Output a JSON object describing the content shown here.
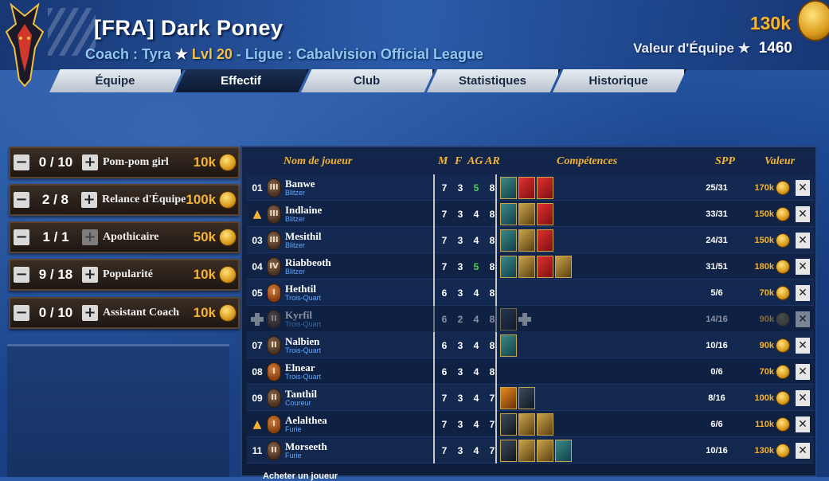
{
  "header": {
    "team_name": "[FRA] Dark Poney",
    "coach_label": "Coach : Tyra",
    "star": "★",
    "level": "Lvl 20",
    "league": " - Ligue : Cabalvision Official League",
    "gold": "130k",
    "team_value_label": "Valeur d'Équipe",
    "team_value": "1460"
  },
  "tabs": [
    {
      "label": "Équipe",
      "active": false
    },
    {
      "label": "Effectif",
      "active": true
    },
    {
      "label": "Club",
      "active": false
    },
    {
      "label": "Statistiques",
      "active": false
    },
    {
      "label": "Historique",
      "active": false
    }
  ],
  "resources": [
    {
      "count": "0 / 10",
      "label": "Pom-pom girl",
      "price": "10k",
      "minus_enabled": true,
      "plus_enabled": true
    },
    {
      "count": "2 / 8",
      "label": "Relance d'Équipe",
      "price": "100k",
      "minus_enabled": true,
      "plus_enabled": true
    },
    {
      "count": "1 / 1",
      "label": "Apothicaire",
      "price": "50k",
      "minus_enabled": true,
      "plus_enabled": false
    },
    {
      "count": "9 / 18",
      "label": "Popularité",
      "price": "10k",
      "minus_enabled": true,
      "plus_enabled": true
    },
    {
      "count": "0 / 10",
      "label": "Assistant Coach",
      "price": "10k",
      "minus_enabled": true,
      "plus_enabled": true
    }
  ],
  "roster_headers": {
    "name": "Nom de joueur",
    "m": "M",
    "f": "F",
    "ag": "AG",
    "ar": "AR",
    "skills": "Compétences",
    "spp": "SPP",
    "value": "Valeur"
  },
  "players": [
    {
      "num": "01",
      "marker": "number",
      "badge": "III",
      "name": "Banwe",
      "pos": "Blitzer",
      "m": "7",
      "f": "3",
      "ag": "5",
      "ag_green": true,
      "ar": "8",
      "skills": [
        "teal",
        "red-white",
        "red"
      ],
      "spp": "25/31",
      "value": "170k",
      "dimmed": false
    },
    {
      "num": "",
      "marker": "promo",
      "badge": "III",
      "name": "Indlaine",
      "pos": "Blitzer",
      "m": "7",
      "f": "3",
      "ag": "4",
      "ag_green": false,
      "ar": "8",
      "skills": [
        "teal",
        "gold",
        "red-white"
      ],
      "spp": "33/31",
      "value": "150k",
      "dimmed": false
    },
    {
      "num": "03",
      "marker": "number",
      "badge": "III",
      "name": "Mesithil",
      "pos": "Blitzer",
      "m": "7",
      "f": "3",
      "ag": "4",
      "ag_green": false,
      "ar": "8",
      "skills": [
        "teal",
        "gold",
        "red-white"
      ],
      "spp": "24/31",
      "value": "150k",
      "dimmed": false
    },
    {
      "num": "04",
      "marker": "number",
      "badge": "IV",
      "name": "Riabbeoth",
      "pos": "Blitzer",
      "m": "7",
      "f": "3",
      "ag": "5",
      "ag_green": true,
      "ar": "8",
      "skills": [
        "teal",
        "gold",
        "red",
        "gold"
      ],
      "spp": "31/51",
      "value": "180k",
      "dimmed": false
    },
    {
      "num": "05",
      "marker": "number",
      "badge": "I",
      "badge_orange": true,
      "name": "Hethtil",
      "pos": "Trois-Quart",
      "m": "6",
      "f": "3",
      "ag": "4",
      "ag_green": false,
      "ar": "8",
      "skills": [],
      "spp": "5/6",
      "value": "70k",
      "dimmed": false
    },
    {
      "num": "",
      "marker": "injury",
      "badge": "II",
      "name": "Kyrfil",
      "pos": "Trois-Quart",
      "m": "6",
      "f": "2",
      "ag": "4",
      "ag_green": false,
      "ar": "8",
      "skills": [
        "dark",
        "cross"
      ],
      "spp": "14/16",
      "value": "90k",
      "dimmed": true
    },
    {
      "num": "07",
      "marker": "number",
      "badge": "II",
      "name": "Nalbien",
      "pos": "Trois-Quart",
      "m": "6",
      "f": "3",
      "ag": "4",
      "ag_green": false,
      "ar": "8",
      "skills": [
        "teal"
      ],
      "spp": "10/16",
      "value": "90k",
      "dimmed": false
    },
    {
      "num": "08",
      "marker": "number",
      "badge": "I",
      "badge_orange": true,
      "name": "Elnear",
      "pos": "Trois-Quart",
      "m": "6",
      "f": "3",
      "ag": "4",
      "ag_green": false,
      "ar": "8",
      "skills": [],
      "spp": "0/6",
      "value": "70k",
      "dimmed": false
    },
    {
      "num": "09",
      "marker": "number",
      "badge": "II",
      "name": "Tanthil",
      "pos": "Coureur",
      "m": "7",
      "f": "3",
      "ag": "4",
      "ag_green": false,
      "ar": "7",
      "skills": [
        "orange",
        "dark"
      ],
      "spp": "8/16",
      "value": "100k",
      "dimmed": false
    },
    {
      "num": "",
      "marker": "promo",
      "badge": "I",
      "badge_orange": true,
      "name": "Aelalthea",
      "pos": "Furie",
      "m": "7",
      "f": "3",
      "ag": "4",
      "ag_green": false,
      "ar": "7",
      "skills": [
        "dark",
        "gold",
        "gold"
      ],
      "spp": "6/6",
      "value": "110k",
      "dimmed": false
    },
    {
      "num": "11",
      "marker": "number",
      "badge": "II",
      "name": "Morseeth",
      "pos": "Furie",
      "m": "7",
      "f": "3",
      "ag": "4",
      "ag_green": false,
      "ar": "7",
      "skills": [
        "dark",
        "gold",
        "gold",
        "teal"
      ],
      "spp": "10/16",
      "value": "130k",
      "dimmed": false
    }
  ],
  "buy_label": "Acheter un joueur",
  "icons": {
    "coin": "gold-coin-icon",
    "delete": "delete-x-icon",
    "promotion": "promotion-chevron-icon",
    "injury": "injury-cross-icon"
  },
  "colors": {
    "gold": "#f3b334",
    "accent_blue": "#5fa8ff",
    "green_stat": "#4ed04e"
  }
}
